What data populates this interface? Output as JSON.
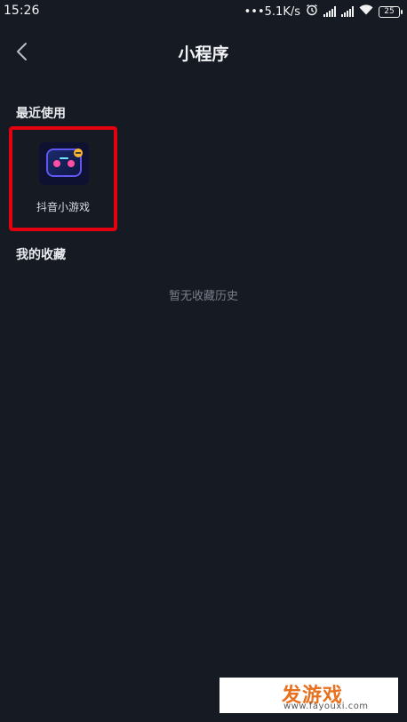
{
  "status_bar": {
    "time": "15:26",
    "net_speed": "•••5.1K/s",
    "battery": "25"
  },
  "header": {
    "title": "小程序"
  },
  "recent": {
    "title": "最近使用",
    "apps": [
      {
        "label": "抖音小游戏",
        "icon": "game-controller-icon"
      }
    ]
  },
  "favorites": {
    "title": "我的收藏",
    "empty_text": "暂无收藏历史"
  },
  "watermark": {
    "brand": "发游戏",
    "url": "www.fayouxi.com"
  },
  "colors": {
    "background": "#161a23",
    "highlight_border": "#e3000f",
    "accent": "#e8711f"
  }
}
